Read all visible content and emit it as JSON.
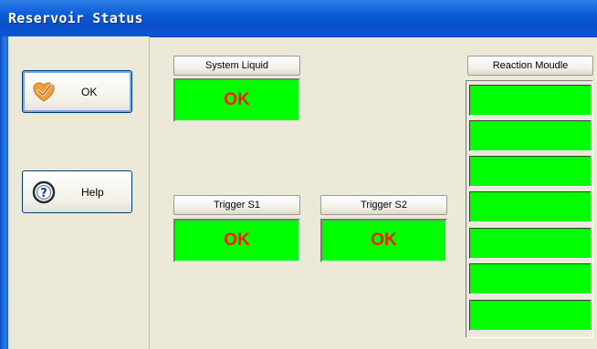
{
  "window": {
    "title": "Reservoir Status"
  },
  "sidebar": {
    "ok_label": "OK",
    "help_label": "Help"
  },
  "panels": {
    "system_liquid": {
      "label": "System Liquid",
      "status": "OK"
    },
    "trigger_s1": {
      "label": "Trigger S1",
      "status": "OK"
    },
    "trigger_s2": {
      "label": "Trigger S2",
      "status": "OK"
    },
    "reaction_module": {
      "label": "Reaction Moudle",
      "cells": 7
    }
  },
  "colors": {
    "status_ok_bg": "#00ff00",
    "status_text": "#ff1a00",
    "titlebar": "#0b5cd8"
  },
  "icons": {
    "ok": "check-heart-icon",
    "help": "help-question-icon"
  }
}
